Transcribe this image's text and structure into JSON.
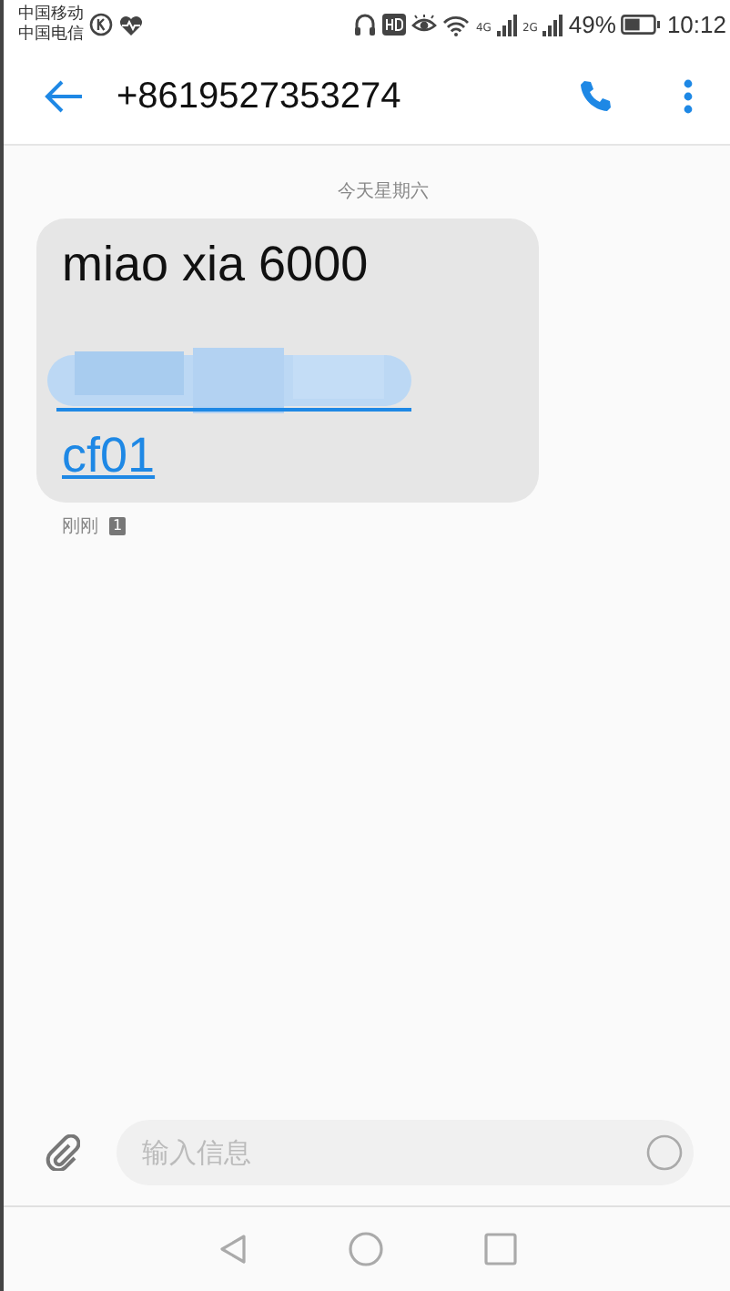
{
  "status_bar": {
    "carriers": [
      "中国移动",
      "中国电信"
    ],
    "network_labels": [
      "4G",
      "2G"
    ],
    "battery": "49%",
    "time": "10:12"
  },
  "header": {
    "title": "+8619527353274"
  },
  "conversation": {
    "date": "今天星期六",
    "messages": [
      {
        "text": "miao xia 6000",
        "link": "cf01",
        "time": "刚刚",
        "sim": "1"
      }
    ]
  },
  "composer": {
    "placeholder": "输入信息"
  }
}
